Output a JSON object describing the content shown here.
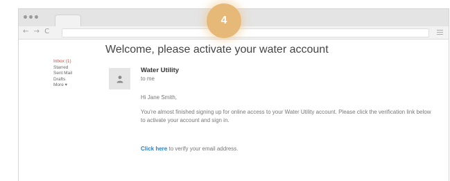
{
  "step_badge": {
    "number": "4"
  },
  "browser": {
    "nav_buttons": "← → C",
    "address_value": ""
  },
  "sidebar": {
    "items": [
      {
        "label": "Inbox (1)"
      },
      {
        "label": "Starred"
      },
      {
        "label": "Sent Mail"
      },
      {
        "label": "Drafts"
      },
      {
        "label": "More ▾"
      }
    ]
  },
  "email": {
    "subject": "Welcome, please activate your water account",
    "sender_name": "Water Utility",
    "sender_to": "to me",
    "greeting": "Hi Jane Smith,",
    "body": "You're almost finished signing up for online access to your Water Utility account. Please click the verification link below to activate your account and sign in.",
    "cta_link": "Click here",
    "cta_rest": " to verify your email address."
  },
  "colors": {
    "badge": "#e6b978",
    "inbox_active": "#e0443a",
    "link": "#2a7fc8"
  },
  "icons": {
    "avatar": "person-icon",
    "menu": "hamburger-menu-icon"
  }
}
